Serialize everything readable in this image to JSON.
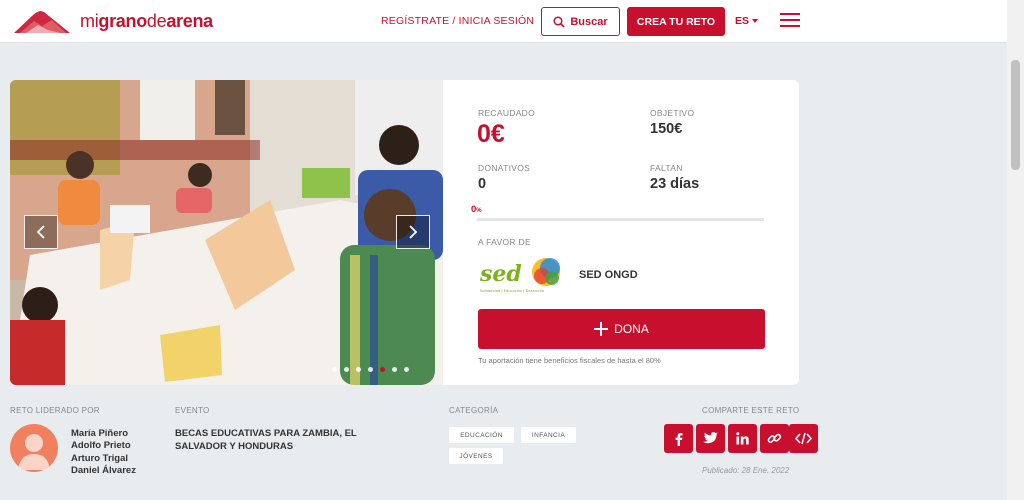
{
  "header": {
    "logo": {
      "w1": "mi",
      "w2": "grano",
      "w3": "de",
      "w4": "arena"
    },
    "register_link": "REGÍSTRATE / INICIA SESIÓN",
    "search_label": "Buscar",
    "create_label": "CREA TU RETO",
    "language": "ES"
  },
  "campaign": {
    "raised_label": "RECAUDADO",
    "raised_value": "0€",
    "goal_label": "OBJETIVO",
    "goal_value": "150€",
    "donations_label": "DONATIVOS",
    "donations_value": "0",
    "remaining_label": "FALTAN",
    "remaining_value": "23 días",
    "progress_percent": "0",
    "progress_unit": "%",
    "beneficiary_label": "A FAVOR DE",
    "beneficiary_name": "SED ONGD",
    "beneficiary_logo_text": "sed",
    "beneficiary_logo_sub": "Solidaridad | Educación | Desarrollo",
    "donate_label": "DONA",
    "fiscal_note": "Tu aportación tiene beneficios fiscales de hasta el 80%"
  },
  "carousel": {
    "slide_count": 7,
    "active_index": 4
  },
  "details": {
    "leader_label": "RETO LIDERADO POR",
    "leaders": [
      "María Piñero",
      "Adolfo Prieto",
      "Arturo Trigal",
      "Daniel Álvarez"
    ],
    "event_label": "EVENTO",
    "event_name": "BECAS EDUCATIVAS PARA ZAMBIA, EL SALVADOR Y HONDURAS",
    "category_label": "CATEGORÍA",
    "categories": [
      "EDUCACIÓN",
      "INFANCIA",
      "JÓVENES"
    ],
    "share_label": "COMPARTE ESTE RETO",
    "share_icons": [
      "facebook-icon",
      "twitter-icon",
      "linkedin-icon",
      "link-icon",
      "embed-icon"
    ],
    "published": "Publicado: 28 Ene. 2022"
  },
  "colors": {
    "brand": "#c8102e",
    "background": "#e9ecef"
  }
}
